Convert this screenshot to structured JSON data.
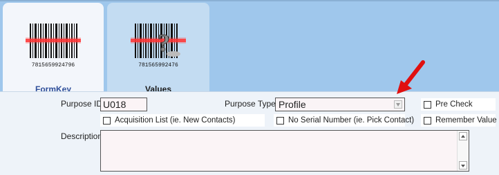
{
  "tabs": [
    {
      "label": "FormKey",
      "barcode_number": "7815659924796",
      "icon": "barcode-icon",
      "active": true
    },
    {
      "label": "Values",
      "barcode_number": "781565992476",
      "icon": "barcode-question-icon",
      "active": false
    }
  ],
  "form": {
    "purpose_id_label": "Purpose ID",
    "purpose_id_value": "U018",
    "purpose_type_label": "Purpose Type",
    "purpose_type_value": "Profile",
    "pre_check_label": "Pre Check",
    "acquisition_list_label": "Acquisition List (ie. New Contacts)",
    "no_serial_label": "No Serial Number (ie. Pick Contact)",
    "remember_value_label": "Remember Value",
    "description_label": "Description",
    "description_value": ""
  },
  "colors": {
    "annotation_arrow": "#e01010",
    "active_tab_label": "#2f4f9a"
  }
}
